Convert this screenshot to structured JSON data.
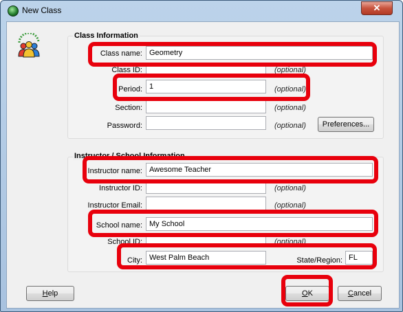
{
  "window": {
    "title": "New Class",
    "close_glyph": "✕"
  },
  "class_info": {
    "title": "Class Information",
    "class_name": {
      "label": "Class name:",
      "value": "Geometry"
    },
    "class_id": {
      "label": "Class ID:",
      "value": "",
      "hint": "(optional)"
    },
    "period": {
      "label": "Period:",
      "value": "1",
      "hint": "(optional)"
    },
    "section": {
      "label": "Section:",
      "value": "",
      "hint": "(optional)"
    },
    "password": {
      "label": "Password:",
      "value": "",
      "hint": "(optional)"
    },
    "preferences_button": "Preferences..."
  },
  "instructor_info": {
    "title": "Instructor / School Information",
    "instructor_name": {
      "label": "Instructor name:",
      "value": "Awesome Teacher"
    },
    "instructor_id": {
      "label": "Instructor ID:",
      "value": "",
      "hint": "(optional)"
    },
    "instructor_email": {
      "label": "Instructor Email:",
      "value": "",
      "hint": "(optional)"
    },
    "school_name": {
      "label": "School name:",
      "value": "My School"
    },
    "school_id": {
      "label": "School ID:",
      "value": "",
      "hint": "(optional)"
    },
    "city": {
      "label": "City:",
      "value": "West Palm Beach"
    },
    "state": {
      "label": "State/Region:",
      "value": "FL"
    }
  },
  "buttons": {
    "help": "Help",
    "ok": "OK",
    "cancel": "Cancel"
  },
  "colors": {
    "highlight": "#e8000c",
    "title_gradient": "#bcd3ea"
  }
}
